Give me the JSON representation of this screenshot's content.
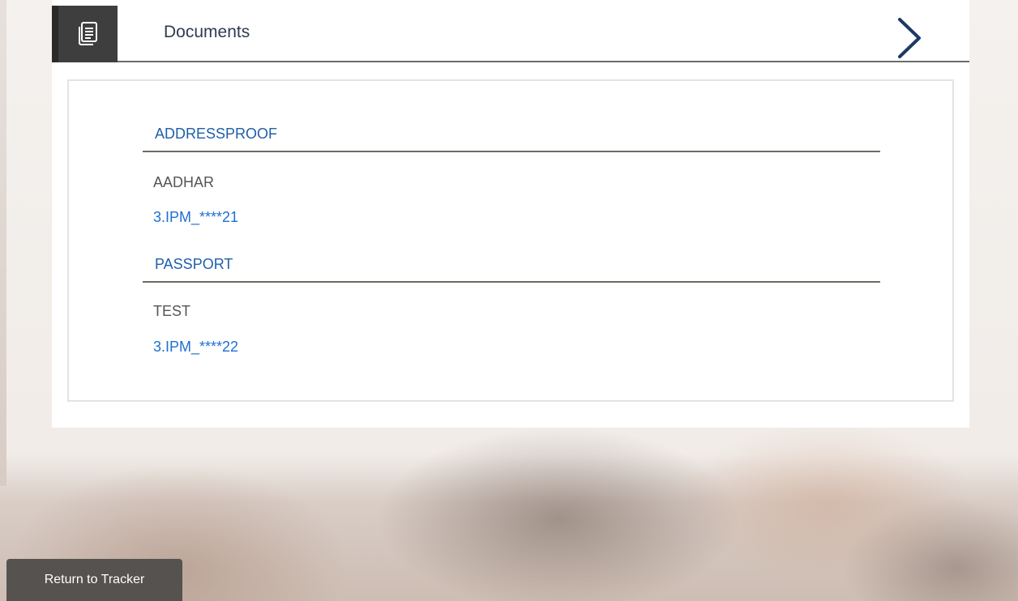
{
  "section": {
    "title": "Documents",
    "icon": "document-stack-icon",
    "expand_icon": "chevron-right-icon"
  },
  "documents": [
    {
      "category": "ADDRESSPROOF",
      "name": "AADHAR",
      "file": "3.IPM_****21"
    },
    {
      "category": "PASSPORT",
      "name": "TEST",
      "file": "3.IPM_****22"
    }
  ],
  "footer": {
    "return_label": "Return to Tracker"
  },
  "colors": {
    "accent_blue": "#1f5fa8",
    "link_blue": "#1f6fd1",
    "icon_bg": "#3e3e3e",
    "button_bg": "#555250"
  }
}
